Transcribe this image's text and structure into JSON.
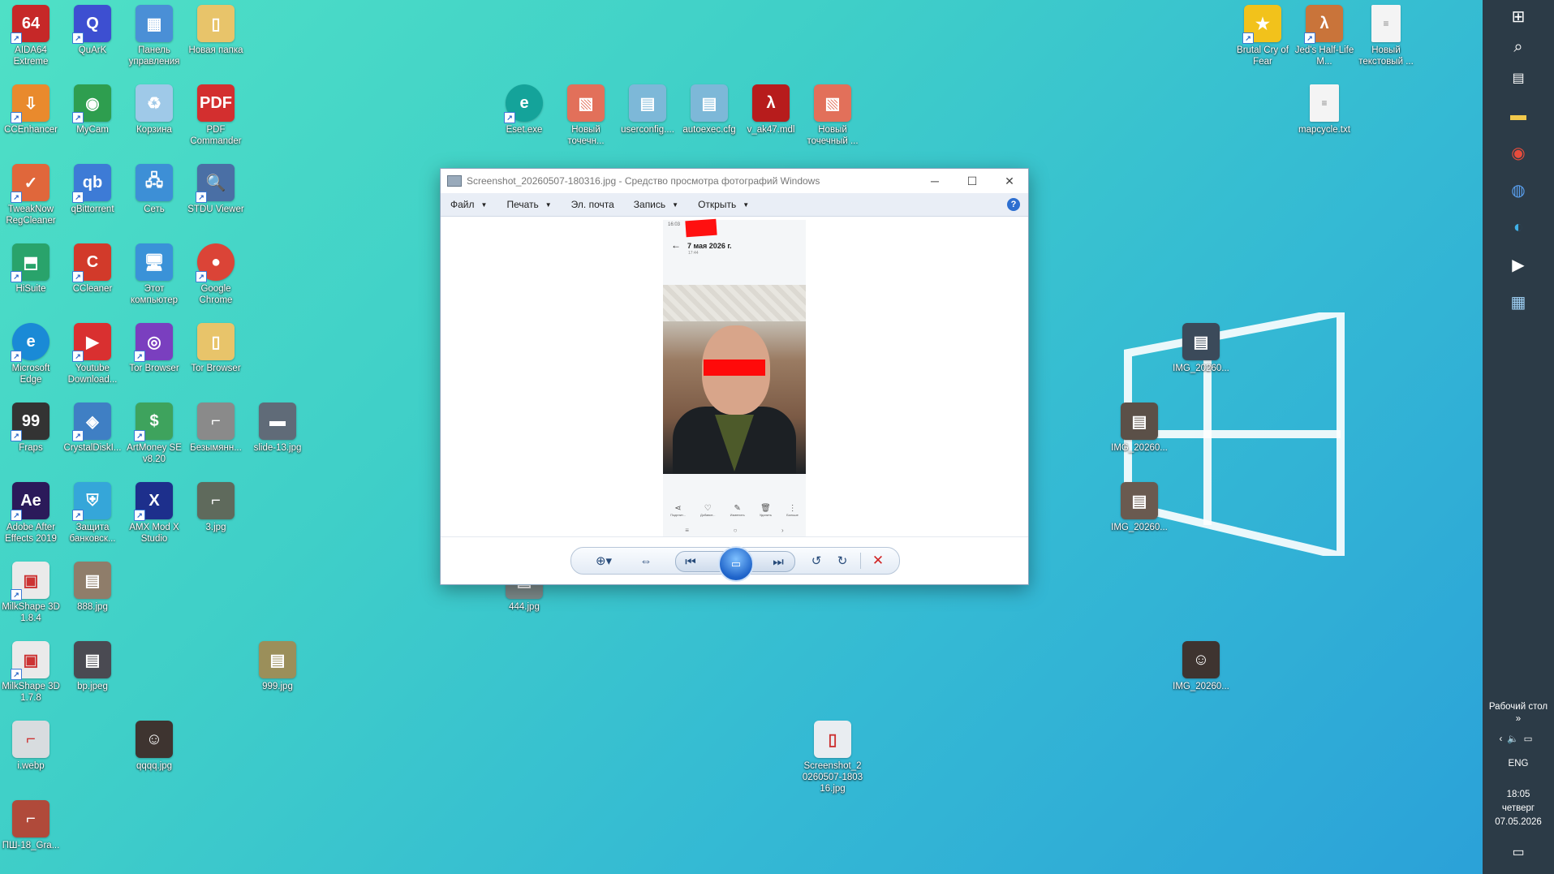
{
  "desktop": {
    "icons": [
      {
        "label": "AIDA64 Extreme",
        "glyph": "64",
        "color": "#c62828"
      },
      {
        "label": "QuArK",
        "glyph": "Q",
        "color": "#3d4fd1"
      },
      {
        "label": "Панель управления",
        "glyph": "▦",
        "color": "#4a8fd6"
      },
      {
        "label": "Новая папка",
        "glyph": "▯",
        "color": "#e8c46a"
      },
      {
        "label": "CCEnhancer",
        "glyph": "⇩",
        "color": "#e98a2d"
      },
      {
        "label": "MyCam",
        "glyph": "◉",
        "color": "#2e9e4f"
      },
      {
        "label": "Корзина",
        "glyph": "♻",
        "color": "#9fc9e8"
      },
      {
        "label": "PDF Commander",
        "glyph": "PDF",
        "color": "#d32f2f"
      },
      {
        "label": "TweakNow RegCleaner",
        "glyph": "✓",
        "color": "#e0673b"
      },
      {
        "label": "qBittorrent",
        "glyph": "qb",
        "color": "#3d7bd6"
      },
      {
        "label": "Сеть",
        "glyph": "🖧",
        "color": "#3d8fd6"
      },
      {
        "label": "STDU Viewer",
        "glyph": "🔍",
        "color": "#4a6fa5"
      },
      {
        "label": "HiSuite",
        "glyph": "⬒",
        "color": "#29a36b"
      },
      {
        "label": "CCleaner",
        "glyph": "C",
        "color": "#d23a2a"
      },
      {
        "label": "Этот компьютер",
        "glyph": "🖥",
        "color": "#3a92d8"
      },
      {
        "label": "Google Chrome",
        "glyph": "●",
        "color": "#db4437"
      },
      {
        "label": "Microsoft Edge",
        "glyph": "e",
        "color": "#1a8ad6"
      },
      {
        "label": "Youtube Download...",
        "glyph": "▶",
        "color": "#d93030"
      },
      {
        "label": "Tor Browser",
        "glyph": "◎",
        "color": "#7a3fbf"
      },
      {
        "label": "Tor Browser",
        "glyph": "▯",
        "color": "#e8c46a"
      },
      {
        "label": "Fraps",
        "glyph": "99",
        "color": "#333333"
      },
      {
        "label": "CrystalDiskI...",
        "glyph": "◈",
        "color": "#3f7fc4"
      },
      {
        "label": "ArtMoney SE v8.20",
        "glyph": "$",
        "color": "#3ea35d"
      },
      {
        "label": "Безымянн...",
        "glyph": "⌐",
        "color": "#8a8a8a"
      },
      {
        "label": "slide-13.jpg",
        "glyph": "▬",
        "color": "#606b78"
      },
      {
        "label": "Adobe After Effects 2019",
        "glyph": "Ae",
        "color": "#2b1a5a"
      },
      {
        "label": "Защита банковск...",
        "glyph": "⛨",
        "color": "#35a6d9"
      },
      {
        "label": "AMX Mod X Studio",
        "glyph": "X",
        "color": "#1d2f8c"
      },
      {
        "label": "3.jpg",
        "glyph": "⌐",
        "color": "#5f6a5c"
      },
      {
        "label": "MilkShape 3D 1.8.4",
        "glyph": "▣",
        "color": "#eaeaea"
      },
      {
        "label": "888.jpg",
        "glyph": "▤",
        "color": "#8f7d6a"
      },
      {
        "label": "444.jpg",
        "glyph": "▤",
        "color": "#7d8a8a"
      },
      {
        "label": "MilkShape 3D 1.7.8",
        "glyph": "▣",
        "color": "#eaeaea"
      },
      {
        "label": "bp.jpeg",
        "glyph": "▤",
        "color": "#4a4a52"
      },
      {
        "label": "999.jpg",
        "glyph": "▤",
        "color": "#9b8f5a"
      },
      {
        "label": "i.webp",
        "glyph": "⌐",
        "color": "#d8dcdf"
      },
      {
        "label": "qqqq.jpg",
        "glyph": "☺",
        "color": "#3e3430"
      },
      {
        "label": "ПШ-18_Gra...",
        "glyph": "⌐",
        "color": "#b04a3a"
      },
      {
        "label": "Eset.exe",
        "glyph": "e",
        "color": "#14a39a"
      },
      {
        "label": "Новый точечн...",
        "glyph": "▧",
        "color": "#e2705a"
      },
      {
        "label": "userconfig....",
        "glyph": "▤",
        "color": "#7db8d8"
      },
      {
        "label": "autoexec.cfg",
        "glyph": "▤",
        "color": "#7db8d8"
      },
      {
        "label": "v_ak47.mdl",
        "glyph": "λ",
        "color": "#b71c1c"
      },
      {
        "label": "Новый точечный ...",
        "glyph": "▧",
        "color": "#e2705a"
      },
      {
        "label": "Brutal Cry of Fear",
        "glyph": "★",
        "color": "#f2c21b"
      },
      {
        "label": "Jed's Half-Life M...",
        "glyph": "λ",
        "color": "#c9743a"
      },
      {
        "label": "Новый текстовый ...",
        "glyph": "≡",
        "color": "#f2f2f2"
      },
      {
        "label": "mapcycle.txt",
        "glyph": "≡",
        "color": "#f2f2f2"
      },
      {
        "label": "IMG_20260...",
        "glyph": "▤",
        "color": "#3b4a5a"
      },
      {
        "label": "IMG_20260...",
        "glyph": "▤",
        "color": "#5b5048"
      },
      {
        "label": "IMG_20260...",
        "glyph": "▤",
        "color": "#6a5a50"
      },
      {
        "label": "IMG_20260...",
        "glyph": "☺",
        "color": "#3e3430"
      },
      {
        "label": "Screenshot_2 0260507-1803 16.jpg",
        "glyph": "▯",
        "color": "#e9edf1"
      }
    ]
  },
  "viewer": {
    "title": "Screenshot_20260507-180316.jpg - Средство просмотра фотографий Windows",
    "menu": [
      {
        "label": "Файл",
        "caret": "▼"
      },
      {
        "label": "Печать",
        "caret": "▼"
      },
      {
        "label": "Эл. почта",
        "caret": ""
      },
      {
        "label": "Запись",
        "caret": "▼"
      },
      {
        "label": "Открыть",
        "caret": "▼"
      }
    ],
    "help_glyph": "?",
    "phone": {
      "status": "16:03",
      "date": "7 мая 2026 г.",
      "sub": "17:44",
      "actions": [
        "Поделит...",
        "Добавит...",
        "Изменить",
        "Удалить",
        "Больше"
      ]
    }
  },
  "taskbar": {
    "desktop_label": "Рабочий стол",
    "chevron": "»",
    "lang": "ENG",
    "time": "18:05",
    "weekday": "четверг",
    "date": "07.05.2026"
  }
}
